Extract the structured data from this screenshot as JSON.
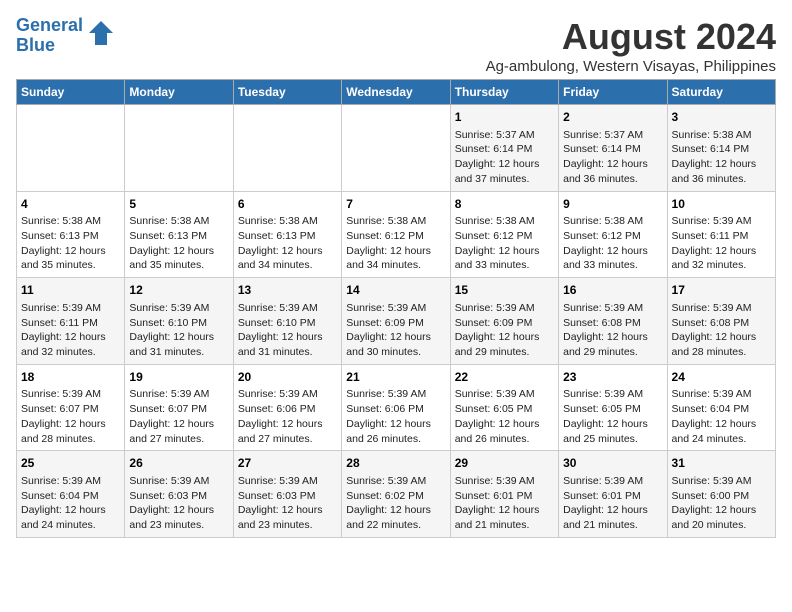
{
  "logo": {
    "line1": "General",
    "line2": "Blue"
  },
  "title": "August 2024",
  "subtitle": "Ag-ambulong, Western Visayas, Philippines",
  "headers": [
    "Sunday",
    "Monday",
    "Tuesday",
    "Wednesday",
    "Thursday",
    "Friday",
    "Saturday"
  ],
  "weeks": [
    [
      {
        "day": "",
        "info": ""
      },
      {
        "day": "",
        "info": ""
      },
      {
        "day": "",
        "info": ""
      },
      {
        "day": "",
        "info": ""
      },
      {
        "day": "1",
        "info": "Sunrise: 5:37 AM\nSunset: 6:14 PM\nDaylight: 12 hours\nand 37 minutes."
      },
      {
        "day": "2",
        "info": "Sunrise: 5:37 AM\nSunset: 6:14 PM\nDaylight: 12 hours\nand 36 minutes."
      },
      {
        "day": "3",
        "info": "Sunrise: 5:38 AM\nSunset: 6:14 PM\nDaylight: 12 hours\nand 36 minutes."
      }
    ],
    [
      {
        "day": "4",
        "info": "Sunrise: 5:38 AM\nSunset: 6:13 PM\nDaylight: 12 hours\nand 35 minutes."
      },
      {
        "day": "5",
        "info": "Sunrise: 5:38 AM\nSunset: 6:13 PM\nDaylight: 12 hours\nand 35 minutes."
      },
      {
        "day": "6",
        "info": "Sunrise: 5:38 AM\nSunset: 6:13 PM\nDaylight: 12 hours\nand 34 minutes."
      },
      {
        "day": "7",
        "info": "Sunrise: 5:38 AM\nSunset: 6:12 PM\nDaylight: 12 hours\nand 34 minutes."
      },
      {
        "day": "8",
        "info": "Sunrise: 5:38 AM\nSunset: 6:12 PM\nDaylight: 12 hours\nand 33 minutes."
      },
      {
        "day": "9",
        "info": "Sunrise: 5:38 AM\nSunset: 6:12 PM\nDaylight: 12 hours\nand 33 minutes."
      },
      {
        "day": "10",
        "info": "Sunrise: 5:39 AM\nSunset: 6:11 PM\nDaylight: 12 hours\nand 32 minutes."
      }
    ],
    [
      {
        "day": "11",
        "info": "Sunrise: 5:39 AM\nSunset: 6:11 PM\nDaylight: 12 hours\nand 32 minutes."
      },
      {
        "day": "12",
        "info": "Sunrise: 5:39 AM\nSunset: 6:10 PM\nDaylight: 12 hours\nand 31 minutes."
      },
      {
        "day": "13",
        "info": "Sunrise: 5:39 AM\nSunset: 6:10 PM\nDaylight: 12 hours\nand 31 minutes."
      },
      {
        "day": "14",
        "info": "Sunrise: 5:39 AM\nSunset: 6:09 PM\nDaylight: 12 hours\nand 30 minutes."
      },
      {
        "day": "15",
        "info": "Sunrise: 5:39 AM\nSunset: 6:09 PM\nDaylight: 12 hours\nand 29 minutes."
      },
      {
        "day": "16",
        "info": "Sunrise: 5:39 AM\nSunset: 6:08 PM\nDaylight: 12 hours\nand 29 minutes."
      },
      {
        "day": "17",
        "info": "Sunrise: 5:39 AM\nSunset: 6:08 PM\nDaylight: 12 hours\nand 28 minutes."
      }
    ],
    [
      {
        "day": "18",
        "info": "Sunrise: 5:39 AM\nSunset: 6:07 PM\nDaylight: 12 hours\nand 28 minutes."
      },
      {
        "day": "19",
        "info": "Sunrise: 5:39 AM\nSunset: 6:07 PM\nDaylight: 12 hours\nand 27 minutes."
      },
      {
        "day": "20",
        "info": "Sunrise: 5:39 AM\nSunset: 6:06 PM\nDaylight: 12 hours\nand 27 minutes."
      },
      {
        "day": "21",
        "info": "Sunrise: 5:39 AM\nSunset: 6:06 PM\nDaylight: 12 hours\nand 26 minutes."
      },
      {
        "day": "22",
        "info": "Sunrise: 5:39 AM\nSunset: 6:05 PM\nDaylight: 12 hours\nand 26 minutes."
      },
      {
        "day": "23",
        "info": "Sunrise: 5:39 AM\nSunset: 6:05 PM\nDaylight: 12 hours\nand 25 minutes."
      },
      {
        "day": "24",
        "info": "Sunrise: 5:39 AM\nSunset: 6:04 PM\nDaylight: 12 hours\nand 24 minutes."
      }
    ],
    [
      {
        "day": "25",
        "info": "Sunrise: 5:39 AM\nSunset: 6:04 PM\nDaylight: 12 hours\nand 24 minutes."
      },
      {
        "day": "26",
        "info": "Sunrise: 5:39 AM\nSunset: 6:03 PM\nDaylight: 12 hours\nand 23 minutes."
      },
      {
        "day": "27",
        "info": "Sunrise: 5:39 AM\nSunset: 6:03 PM\nDaylight: 12 hours\nand 23 minutes."
      },
      {
        "day": "28",
        "info": "Sunrise: 5:39 AM\nSunset: 6:02 PM\nDaylight: 12 hours\nand 22 minutes."
      },
      {
        "day": "29",
        "info": "Sunrise: 5:39 AM\nSunset: 6:01 PM\nDaylight: 12 hours\nand 21 minutes."
      },
      {
        "day": "30",
        "info": "Sunrise: 5:39 AM\nSunset: 6:01 PM\nDaylight: 12 hours\nand 21 minutes."
      },
      {
        "day": "31",
        "info": "Sunrise: 5:39 AM\nSunset: 6:00 PM\nDaylight: 12 hours\nand 20 minutes."
      }
    ]
  ]
}
